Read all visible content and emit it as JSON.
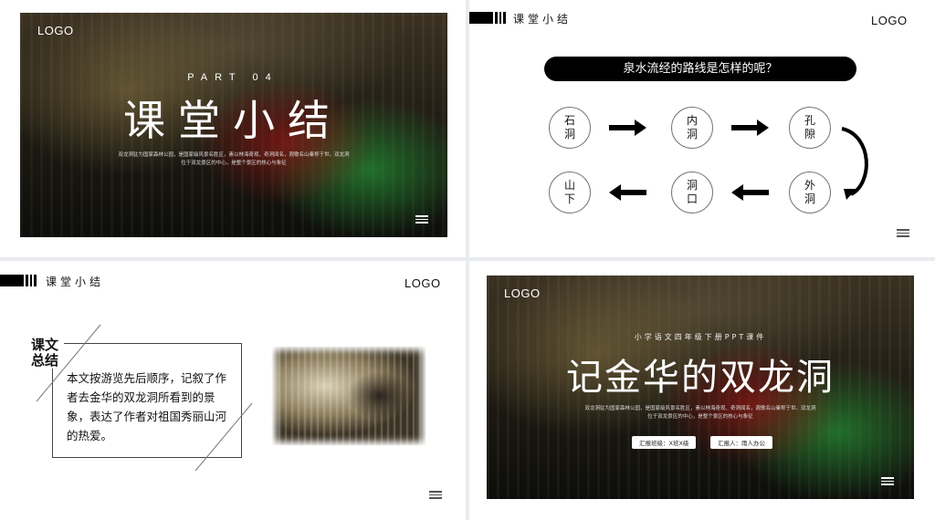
{
  "slide1": {
    "logo": "LOGO",
    "part": "PART 04",
    "title": "课堂小结",
    "desc_line1": "双龙洞驻为国家森林公园，是国家级风景名胜区，素以林海奇观、奇洞闻名，遐歌名山秦称于世。双龙洞",
    "desc_line2": "位于双龙景区的中心，是整个景区的核心与象征"
  },
  "slide2": {
    "section_label": "课堂小结",
    "logo": "LOGO",
    "question": "泉水流经的路线是怎样的呢？",
    "nodes": [
      "石洞",
      "内洞",
      "孔隙",
      "外洞",
      "洞口",
      "山下"
    ]
  },
  "slide3": {
    "section_label": "课堂小结",
    "logo": "LOGO",
    "keyword": "课文总结",
    "summary": "本文按游览先后顺序，记叙了作者去金华的双龙洞所看到的景象，表达了作者对祖国秀丽山河的热爱。"
  },
  "slide4": {
    "logo": "LOGO",
    "subtitle": "小学语文四年级下册PPT课件",
    "title": "记金华的双龙洞",
    "desc_line1": "双龙洞驻为国家森林公园，是国家级风景名胜区，素以林海奇观、奇洞闻名，遐歌名山秦称于世。双龙洞",
    "desc_line2": "位于双龙景区的中心，是整个景区的核心与象征",
    "class_label": "汇报班级：X班X级",
    "presenter_label": "汇报人：雨人办公"
  }
}
